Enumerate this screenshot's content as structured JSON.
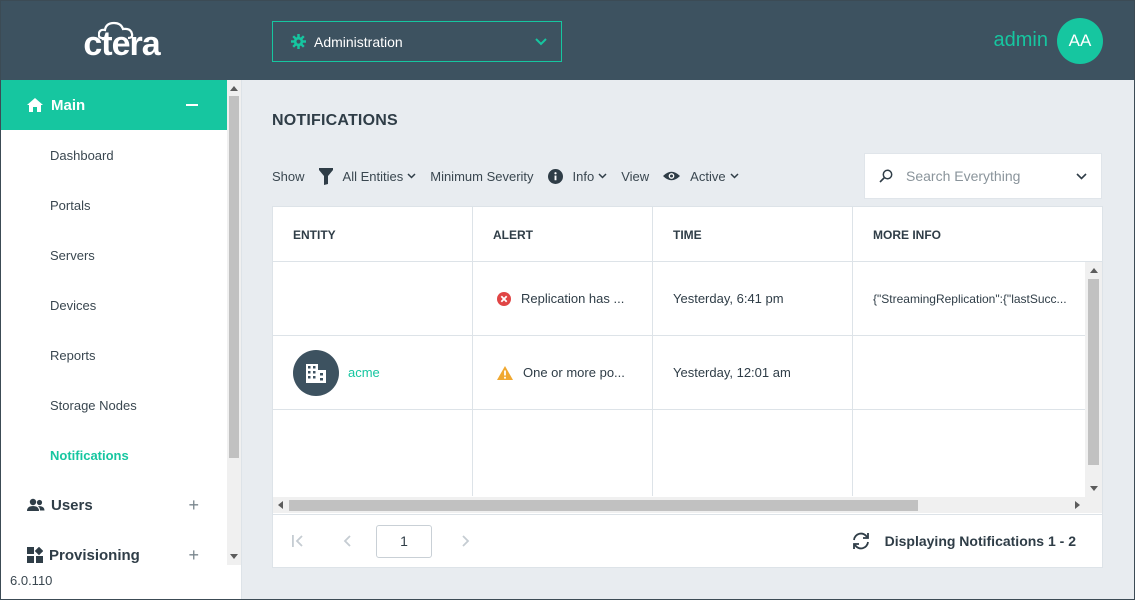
{
  "app": {
    "logo": "ctera",
    "version": "6.0.110"
  },
  "header": {
    "context_select": {
      "label": "Administration",
      "icon": "gear-icon"
    },
    "user": {
      "name": "admin",
      "initials": "AA"
    }
  },
  "sidebar": {
    "main": {
      "label": "Main",
      "icon": "home-icon"
    },
    "items": [
      {
        "label": "Dashboard",
        "active": false
      },
      {
        "label": "Portals",
        "active": false
      },
      {
        "label": "Servers",
        "active": false
      },
      {
        "label": "Devices",
        "active": false
      },
      {
        "label": "Reports",
        "active": false
      },
      {
        "label": "Storage Nodes",
        "active": false
      },
      {
        "label": "Notifications",
        "active": true
      }
    ],
    "groups": [
      {
        "label": "Users",
        "icon": "users-icon"
      },
      {
        "label": "Provisioning",
        "icon": "provisioning-icon"
      }
    ]
  },
  "page": {
    "title": "NOTIFICATIONS",
    "filters": {
      "show_label": "Show",
      "entities_value": "All Entities",
      "severity_label": "Minimum Severity",
      "severity_value": "Info",
      "view_label": "View",
      "view_value": "Active"
    },
    "search": {
      "placeholder": "Search Everything"
    }
  },
  "table": {
    "columns": [
      "ENTITY",
      "ALERT",
      "TIME",
      "MORE INFO"
    ],
    "rows": [
      {
        "entity": "",
        "severity": "error",
        "alert": "Replication has ...",
        "time": "Yesterday, 6:41 pm",
        "more_info": "{\"StreamingReplication\":{\"lastSucc..."
      },
      {
        "entity": "acme",
        "severity": "warning",
        "alert": "One or more po...",
        "time": "Yesterday, 12:01 am",
        "more_info": ""
      }
    ]
  },
  "pager": {
    "current_page": "1",
    "info": "Displaying Notifications 1 - 2"
  },
  "colors": {
    "accent": "#16c6a0",
    "header_bg": "#3d5260",
    "error": "#e04545",
    "warning": "#f0a830"
  }
}
